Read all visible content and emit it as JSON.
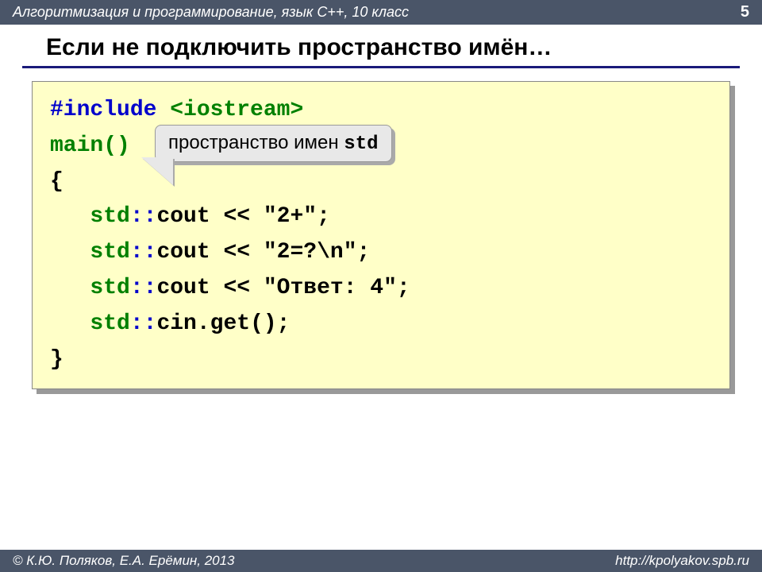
{
  "header": {
    "course": "Алгоритмизация и программирование, язык  C++, 10 класс",
    "page": "5"
  },
  "title": "Если не подключить пространство имён…",
  "callout": {
    "text": "пространство имен ",
    "mono": "std"
  },
  "code": {
    "l1_include": "#include ",
    "l1_iostream": "<iostream>",
    "l2_main": "main()",
    "l3": "{",
    "indent": "   ",
    "std": "std",
    "sep": "::",
    "l4_rest": "cout << \"2+\";",
    "l5_rest": "cout << \"2=?\\n\";",
    "l6_rest": "cout << \"Ответ: 4\";",
    "l7_rest": "cin.get();",
    "l8": "}"
  },
  "footer": {
    "authors": "© К.Ю. Поляков, Е.А. Ерёмин, 2013",
    "url": "http://kpolyakov.spb.ru"
  }
}
